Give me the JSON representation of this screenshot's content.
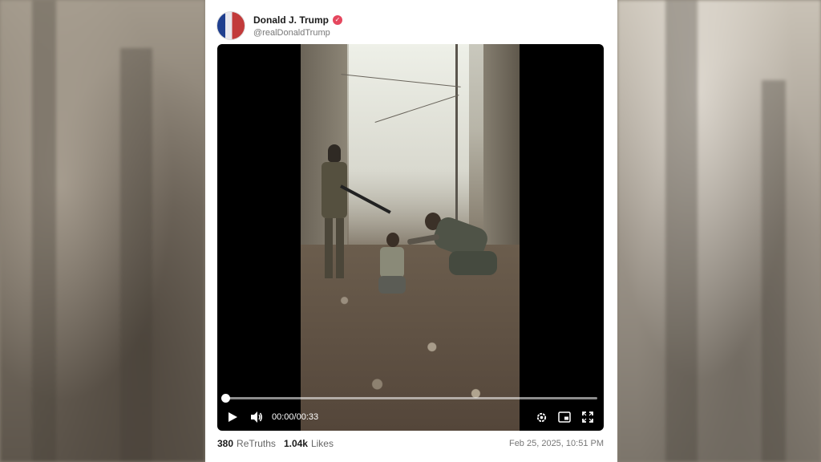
{
  "author": {
    "display_name": "Donald J. Trump",
    "handle": "@realDonaldTrump",
    "verified": true
  },
  "video": {
    "current_time": "00:00",
    "separator": "/",
    "duration": "00:33",
    "progress_fraction": 0.0
  },
  "stats": {
    "retruths_count": "380",
    "retruths_label": "ReTruths",
    "likes_count": "1.04k",
    "likes_label": "Likes"
  },
  "timestamp": "Feb 25, 2025, 10:51 PM",
  "icons": {
    "verified": "verified-badge-icon",
    "play": "play-icon",
    "volume": "volume-icon",
    "settings": "gear-icon",
    "pip": "picture-in-picture-icon",
    "fullscreen": "fullscreen-icon"
  },
  "colors": {
    "verified_badge": "#e5475e",
    "video_background": "#000000"
  }
}
